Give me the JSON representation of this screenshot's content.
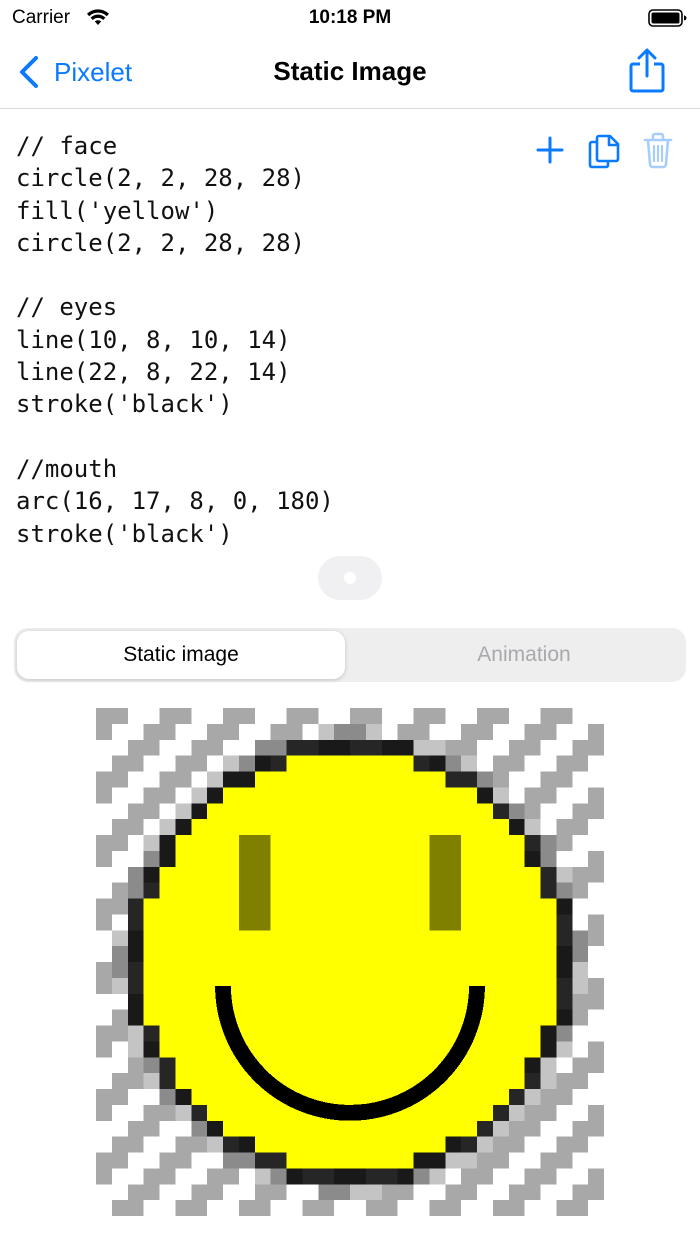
{
  "status_bar": {
    "carrier": "Carrier",
    "time": "10:18 PM"
  },
  "nav": {
    "back_label": "Pixelet",
    "title": "Static Image"
  },
  "code_lines": [
    "// face",
    "circle(2, 2, 28, 28)",
    "fill('yellow')",
    "circle(2, 2, 28, 28)",
    "",
    "// eyes",
    "line(10, 8, 10, 14)",
    "line(22, 8, 22, 14)",
    "stroke('black')",
    "",
    "//mouth",
    "arc(16, 17, 8, 0, 180)",
    "stroke('black')"
  ],
  "tools": [
    "plus-icon",
    "copy-icon",
    "trash-icon"
  ],
  "segmented": {
    "options": [
      "Static image",
      "Animation"
    ],
    "selected": 0
  },
  "preview": {
    "grid_size": 32,
    "face_color": "#ffff00",
    "feature_color": "#808000",
    "outline_color": "#000000",
    "checker_stripes": "#a8a8a8"
  },
  "colors": {
    "accent": "#0a7aff",
    "tool_disabled": "#a7cdfb"
  }
}
